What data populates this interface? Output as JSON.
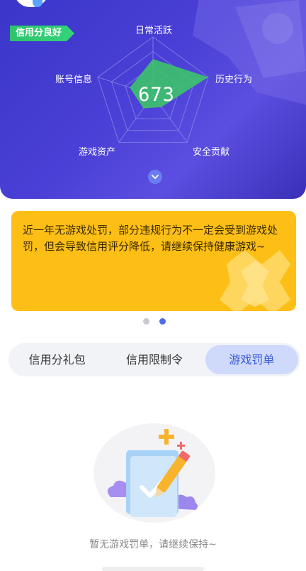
{
  "hero": {
    "badge": "信用分良好",
    "score": "673",
    "radar": {
      "axes": [
        "日常活跃",
        "历史行为",
        "安全贡献",
        "游戏资产",
        "账号信息"
      ],
      "values": [
        0.62,
        1.0,
        0.25,
        0.28,
        0.42
      ]
    },
    "expand_icon": "chevron-down-icon",
    "colors": {
      "background": "#3f39cc",
      "radar_fill": "#3cc36a"
    }
  },
  "notice": {
    "text": "近一年无游戏处罚，部分违规行为不一定会受到游戏处罚，但会导致信用评分降低，请继续保持健康游戏~",
    "background": "#fdbf16"
  },
  "carousel": {
    "total": 2,
    "active": 2
  },
  "tabs": [
    {
      "label": "信用分礼包",
      "active": false
    },
    {
      "label": "信用限制令",
      "active": false
    },
    {
      "label": "游戏罚单",
      "active": true
    }
  ],
  "empty_state": {
    "icon": "document-pencil-icon",
    "message": "暂无游戏罚单，请继续保持~"
  }
}
